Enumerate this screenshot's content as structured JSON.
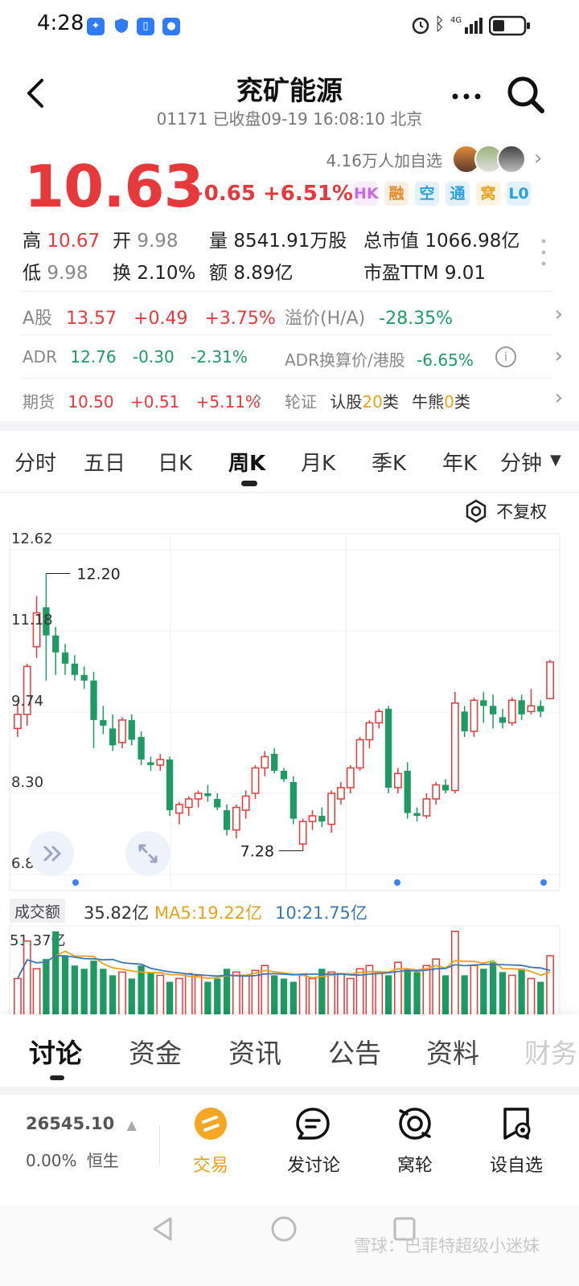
{
  "status_bar": {
    "time": "4:28"
  },
  "header": {
    "title": "兖矿能源",
    "subtitle": "01171 已收盘09-19 16:08:10 北京"
  },
  "followers": "4.16万人加自选",
  "quote": {
    "price": "10.63",
    "change": "+0.65",
    "change_pct": "+6.51%",
    "tags": [
      "HK",
      "融",
      "空",
      "通",
      "窝",
      "L0"
    ],
    "tag_colors": [
      "#c86be0",
      "#e08a2c",
      "#2ea0d8",
      "#2ea0d8",
      "#e8a21c",
      "#2ea0d8"
    ]
  },
  "stats": {
    "high_label": "高",
    "high": "10.67",
    "open_label": "开",
    "open": "9.98",
    "vol_label": "量",
    "vol": "8541.91万股",
    "mcap_label": "总市值",
    "mcap": "1066.98亿",
    "low_label": "低",
    "low": "9.98",
    "turn_label": "换",
    "turn": "2.10%",
    "amt_label": "额",
    "amt": "8.89亿",
    "pe_label": "市盈TTM",
    "pe": "9.01"
  },
  "rows": {
    "a_label": "A股",
    "a_price": "13.57",
    "a_chg": "+0.49",
    "a_pct": "+3.75%",
    "prem_label": "溢价(H/A)",
    "prem": "-28.35%",
    "adr_label": "ADR",
    "adr_price": "12.76",
    "adr_chg": "-0.30",
    "adr_pct": "-2.31%",
    "adr_conv_label": "ADR换算价/港股",
    "adr_conv": "-6.65%",
    "fut_label": "期货",
    "fut_price": "10.50",
    "fut_chg": "+0.51",
    "fut_pct": "+5.11%",
    "warrant_label": "轮证",
    "call_label": "认股",
    "call_n": "20",
    "call_suffix": "类",
    "cbbc_label": "牛熊",
    "cbbc_n": "0",
    "cbbc_suffix": "类"
  },
  "period_tabs": [
    "分时",
    "五日",
    "日K",
    "周K",
    "月K",
    "季K",
    "年K",
    "分钟"
  ],
  "adjust_label": "不复权",
  "chart_data": {
    "type": "candlestick",
    "y_ticks": [
      "12.62",
      "11.18",
      "9.74",
      "8.30",
      "6.86"
    ],
    "ylim": [
      6.86,
      12.62
    ],
    "annotations": {
      "high": "12.20",
      "low": "7.28"
    },
    "candles": [
      {
        "o": 9.45,
        "h": 9.9,
        "l": 9.3,
        "c": 9.7
      },
      {
        "o": 9.7,
        "h": 10.6,
        "l": 9.5,
        "c": 10.55
      },
      {
        "o": 10.9,
        "h": 11.8,
        "l": 10.7,
        "c": 11.5
      },
      {
        "o": 11.6,
        "h": 12.2,
        "l": 10.3,
        "c": 11.1
      },
      {
        "o": 11.1,
        "h": 11.25,
        "l": 10.4,
        "c": 10.8
      },
      {
        "o": 10.8,
        "h": 10.95,
        "l": 10.4,
        "c": 10.6
      },
      {
        "o": 10.6,
        "h": 10.75,
        "l": 10.3,
        "c": 10.4
      },
      {
        "o": 10.4,
        "h": 10.55,
        "l": 10.15,
        "c": 10.3
      },
      {
        "o": 10.3,
        "h": 10.45,
        "l": 9.1,
        "c": 9.6
      },
      {
        "o": 9.6,
        "h": 9.85,
        "l": 9.35,
        "c": 9.5
      },
      {
        "o": 9.45,
        "h": 9.7,
        "l": 9.05,
        "c": 9.15
      },
      {
        "o": 9.2,
        "h": 9.65,
        "l": 9.1,
        "c": 9.6
      },
      {
        "o": 9.6,
        "h": 9.7,
        "l": 9.15,
        "c": 9.25
      },
      {
        "o": 9.3,
        "h": 9.4,
        "l": 8.8,
        "c": 8.9
      },
      {
        "o": 8.85,
        "h": 8.95,
        "l": 8.7,
        "c": 8.8
      },
      {
        "o": 8.8,
        "h": 9.0,
        "l": 8.7,
        "c": 8.9
      },
      {
        "o": 8.9,
        "h": 8.95,
        "l": 7.9,
        "c": 8.0
      },
      {
        "o": 7.95,
        "h": 8.15,
        "l": 7.75,
        "c": 8.1
      },
      {
        "o": 8.05,
        "h": 8.25,
        "l": 7.9,
        "c": 8.2
      },
      {
        "o": 8.2,
        "h": 8.35,
        "l": 8.05,
        "c": 8.3
      },
      {
        "o": 8.3,
        "h": 8.45,
        "l": 8.15,
        "c": 8.25
      },
      {
        "o": 8.2,
        "h": 8.3,
        "l": 8.0,
        "c": 8.05
      },
      {
        "o": 8.0,
        "h": 8.1,
        "l": 7.55,
        "c": 7.65
      },
      {
        "o": 7.65,
        "h": 8.1,
        "l": 7.5,
        "c": 8.05
      },
      {
        "o": 8.0,
        "h": 8.35,
        "l": 7.85,
        "c": 8.25
      },
      {
        "o": 8.3,
        "h": 8.8,
        "l": 8.2,
        "c": 8.75
      },
      {
        "o": 8.75,
        "h": 9.05,
        "l": 8.6,
        "c": 8.95
      },
      {
        "o": 9.0,
        "h": 9.1,
        "l": 8.65,
        "c": 8.7
      },
      {
        "o": 8.7,
        "h": 8.75,
        "l": 8.5,
        "c": 8.55
      },
      {
        "o": 8.5,
        "h": 8.6,
        "l": 7.75,
        "c": 7.85
      },
      {
        "o": 7.4,
        "h": 7.85,
        "l": 7.28,
        "c": 7.8
      },
      {
        "o": 7.8,
        "h": 8.0,
        "l": 7.65,
        "c": 7.9
      },
      {
        "o": 7.9,
        "h": 8.05,
        "l": 7.7,
        "c": 7.8
      },
      {
        "o": 7.75,
        "h": 8.35,
        "l": 7.6,
        "c": 8.3
      },
      {
        "o": 8.2,
        "h": 8.5,
        "l": 8.1,
        "c": 8.4
      },
      {
        "o": 8.4,
        "h": 8.8,
        "l": 8.3,
        "c": 8.75
      },
      {
        "o": 8.75,
        "h": 9.3,
        "l": 8.7,
        "c": 9.25
      },
      {
        "o": 9.25,
        "h": 9.6,
        "l": 9.1,
        "c": 9.55
      },
      {
        "o": 9.55,
        "h": 9.8,
        "l": 9.45,
        "c": 9.75
      },
      {
        "o": 9.8,
        "h": 9.85,
        "l": 8.3,
        "c": 8.4
      },
      {
        "o": 8.4,
        "h": 8.75,
        "l": 8.3,
        "c": 8.65
      },
      {
        "o": 8.7,
        "h": 8.85,
        "l": 7.85,
        "c": 7.95
      },
      {
        "o": 7.95,
        "h": 8.05,
        "l": 7.8,
        "c": 7.9
      },
      {
        "o": 7.9,
        "h": 8.3,
        "l": 7.85,
        "c": 8.2
      },
      {
        "o": 8.2,
        "h": 8.5,
        "l": 8.1,
        "c": 8.45
      },
      {
        "o": 8.45,
        "h": 8.55,
        "l": 8.3,
        "c": 8.35
      },
      {
        "o": 8.35,
        "h": 10.1,
        "l": 8.3,
        "c": 9.9
      },
      {
        "o": 9.75,
        "h": 9.85,
        "l": 9.3,
        "c": 9.4
      },
      {
        "o": 9.4,
        "h": 10.0,
        "l": 9.3,
        "c": 9.95
      },
      {
        "o": 9.95,
        "h": 10.1,
        "l": 9.55,
        "c": 9.85
      },
      {
        "o": 9.85,
        "h": 10.05,
        "l": 9.45,
        "c": 9.7
      },
      {
        "o": 9.65,
        "h": 9.8,
        "l": 9.45,
        "c": 9.55
      },
      {
        "o": 9.55,
        "h": 10.0,
        "l": 9.5,
        "c": 9.95
      },
      {
        "o": 9.95,
        "h": 10.05,
        "l": 9.6,
        "c": 9.7
      },
      {
        "o": 9.75,
        "h": 10.15,
        "l": 9.7,
        "c": 9.85
      },
      {
        "o": 9.85,
        "h": 9.95,
        "l": 9.65,
        "c": 9.75
      },
      {
        "o": 9.98,
        "h": 10.67,
        "l": 9.98,
        "c": 10.63
      }
    ],
    "volume": {
      "label": "成交额",
      "current": "35.82亿",
      "ma5": "MA5:19.22亿",
      "ma10": "10:21.75亿",
      "max_label": "51.37亿",
      "values": [
        22,
        45,
        28,
        34,
        51,
        36,
        30,
        28,
        33,
        28,
        24,
        26,
        22,
        30,
        26,
        24,
        20,
        22,
        25,
        24,
        20,
        22,
        28,
        26,
        24,
        27,
        30,
        24,
        22,
        20,
        24,
        22,
        28,
        26,
        25,
        22,
        28,
        30,
        26,
        24,
        32,
        28,
        26,
        30,
        34,
        24,
        51,
        24,
        30,
        28,
        32,
        26,
        24,
        28,
        22,
        20,
        36
      ]
    },
    "colors": {
      "up": "#e5393b",
      "down": "#1f9a63",
      "ma5": "#e8a21c",
      "ma10": "#3a78b5"
    }
  },
  "bottom_tabs": [
    "讨论",
    "资金",
    "资讯",
    "公告",
    "资料",
    "财务"
  ],
  "bottom_bar": {
    "index_value": "26545.10",
    "index_pct": "0.00%",
    "index_name": "恒生",
    "trade_label": "交易",
    "post_label": "发讨论",
    "wolun_label": "窝轮",
    "watch_label": "设自选"
  },
  "watermark": "雪球：巴菲特超级小迷妹"
}
